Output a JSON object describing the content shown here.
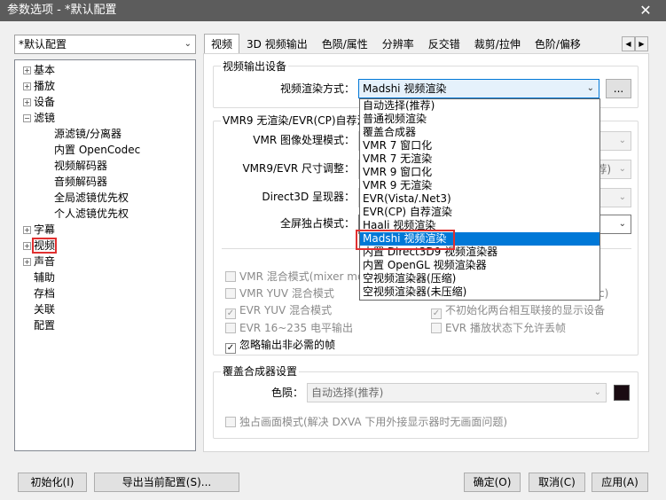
{
  "window": {
    "title": "参数选项 - *默认配置",
    "close_glyph": "✕"
  },
  "preset": {
    "value": "*默认配置"
  },
  "tree": [
    {
      "label": "基本",
      "expander": "+"
    },
    {
      "label": "播放",
      "expander": "+"
    },
    {
      "label": "设备",
      "expander": "+"
    },
    {
      "label": "滤镜",
      "expander": "−"
    },
    {
      "label": "源滤镜/分离器",
      "expander": ""
    },
    {
      "label": "内置 OpenCodec",
      "expander": ""
    },
    {
      "label": "视频解码器",
      "expander": ""
    },
    {
      "label": "音频解码器",
      "expander": ""
    },
    {
      "label": "全局滤镜优先权",
      "expander": ""
    },
    {
      "label": "个人滤镜优先权",
      "expander": ""
    },
    {
      "label": "字幕",
      "expander": "+"
    },
    {
      "label": "视频",
      "expander": "+"
    },
    {
      "label": "声音",
      "expander": "+"
    },
    {
      "label": "辅助",
      "expander": ""
    },
    {
      "label": "存档",
      "expander": ""
    },
    {
      "label": "关联",
      "expander": ""
    },
    {
      "label": "配置",
      "expander": ""
    }
  ],
  "tabs": [
    "视频",
    "3D 视频输出",
    "色陨/属性",
    "分辨率",
    "反交错",
    "裁剪/拉伸",
    "色阶/偏移"
  ],
  "tab_scroll": {
    "left": "◀",
    "right": "▶"
  },
  "output_device": {
    "group_label": "视频输出设备",
    "renderer_label": "视频渲染方式：",
    "renderer_value": "Madshi 视频渲染",
    "more_button": "..."
  },
  "vmr_group": {
    "label": "VMR9 无渲染/EVR(CP)自荐渲",
    "image_processing_label": "VMR 图像处理模式：",
    "size_adjust_label": "VMR9/EVR 尺寸调整：",
    "size_adjust_value": "荐)",
    "d3d_label": "Direct3D 呈现器：",
    "exclusive_label": "全屏独占模式："
  },
  "dropdown_options": [
    "自动选择(推荐)",
    "普通视频渲染",
    "覆盖合成器",
    "VMR 7 窗口化",
    "VMR 7 无渲染",
    "VMR 9 窗口化",
    "VMR 9 无渲染",
    "EVR(Vista/.Net3)",
    "EVR(CP) 自荐渲染",
    "Haali 视频渲染",
    "Madshi 视频渲染",
    "内置 Direct3D9 视频渲染器",
    "内置 OpenGL 视频渲染器",
    "空视频渲染器(压缩)",
    "空视频渲染器(未压缩)"
  ],
  "dropdown_selected_index": 10,
  "checkboxes": {
    "mixer_mode": {
      "label": "VMR 混合模式(mixer mo",
      "checked": false
    },
    "yuv_mix": {
      "label": "VMR YUV 混合模式",
      "checked": false
    },
    "yuv_mix_right_suffix": "c)",
    "evr_yuv_mix": {
      "label": "EVR YUV 混合模式",
      "checked": true
    },
    "no_init_displays": {
      "label": "不初始化两台相互联接的显示设备",
      "checked": true
    },
    "evr_16_235": {
      "label": "EVR 16~235 电平输出",
      "checked": false
    },
    "evr_drop_frames": {
      "label": "EVR 播放状态下允许丢帧",
      "checked": false
    },
    "ignore_frames": {
      "label": "忽略输出非必需的帧",
      "checked": true
    },
    "exclusive_mode": {
      "label": "独占画面模式(解决 DXVA 下用外接显示器时无画面问题)",
      "checked": false
    }
  },
  "overlay": {
    "group_label": "覆盖合成器设置",
    "color_label": "色陨：",
    "color_value": "自动选择(推荐)",
    "swatch_color": "#1a0b12"
  },
  "bottom_buttons": {
    "init": "初始化(I)",
    "export": "导出当前配置(S)...",
    "ok": "确定(O)",
    "cancel": "取消(C)",
    "apply": "应用(A)"
  },
  "icons": {
    "combo_arrow": "⌄",
    "check_mark": "✓"
  }
}
